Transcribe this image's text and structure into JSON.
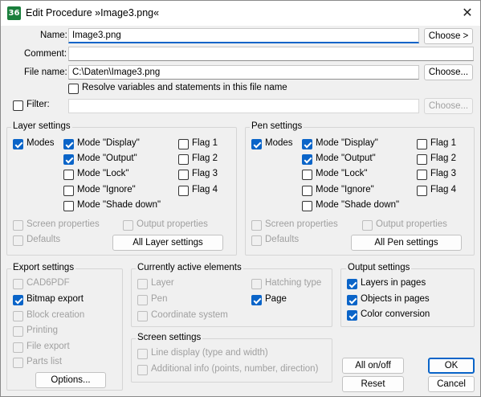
{
  "titlebar": {
    "app_icon": "36",
    "title": "Edit Procedure »Image3.png«",
    "close_glyph": "✕"
  },
  "form": {
    "name_label": "Name:",
    "name_value": "Image3.png",
    "name_choose": "Choose >",
    "comment_label": "Comment:",
    "comment_value": "",
    "filename_label": "File name:",
    "filename_value": "C:\\Daten\\Image3.png",
    "filename_choose": "Choose...",
    "resolve_label": "Resolve variables and statements in this file name",
    "filter_label": "Filter:",
    "filter_value": "",
    "filter_choose": "Choose..."
  },
  "layer_settings": {
    "title": "Layer settings",
    "modes": "Modes",
    "mode_display": "Mode \"Display\"",
    "mode_output": "Mode \"Output\"",
    "mode_lock": "Mode \"Lock\"",
    "mode_ignore": "Mode \"Ignore\"",
    "mode_shade": "Mode \"Shade down\"",
    "flag1": "Flag 1",
    "flag2": "Flag 2",
    "flag3": "Flag 3",
    "flag4": "Flag 4",
    "screen_props": "Screen properties",
    "output_props": "Output properties",
    "defaults": "Defaults",
    "all_button": "All Layer settings"
  },
  "pen_settings": {
    "title": "Pen settings",
    "modes": "Modes",
    "mode_display": "Mode \"Display\"",
    "mode_output": "Mode \"Output\"",
    "mode_lock": "Mode \"Lock\"",
    "mode_ignore": "Mode \"Ignore\"",
    "mode_shade": "Mode \"Shade down\"",
    "flag1": "Flag 1",
    "flag2": "Flag 2",
    "flag3": "Flag 3",
    "flag4": "Flag 4",
    "screen_props": "Screen properties",
    "output_props": "Output properties",
    "defaults": "Defaults",
    "all_button": "All Pen settings"
  },
  "export_settings": {
    "title": "Export settings",
    "cad6pdf": "CAD6PDF",
    "bitmap": "Bitmap export",
    "block": "Block creation",
    "printing": "Printing",
    "file_export": "File export",
    "parts": "Parts list",
    "options_button": "Options..."
  },
  "active_elements": {
    "title": "Currently active elements",
    "layer": "Layer",
    "pen": "Pen",
    "coord": "Coordinate system",
    "hatching": "Hatching type",
    "page": "Page"
  },
  "screen_settings": {
    "title": "Screen settings",
    "line_display": "Line display (type and width)",
    "additional_info": "Additional info (points, number, direction)"
  },
  "output_settings": {
    "title": "Output settings",
    "layers_in_pages": "Layers in pages",
    "objects_in_pages": "Objects in pages",
    "color_conversion": "Color conversion"
  },
  "buttons": {
    "all_onoff": "All on/off",
    "reset": "Reset",
    "ok": "OK",
    "cancel": "Cancel"
  },
  "colors": {
    "accent": "#0a64c8",
    "disabled_text": "#a0a0a0"
  }
}
